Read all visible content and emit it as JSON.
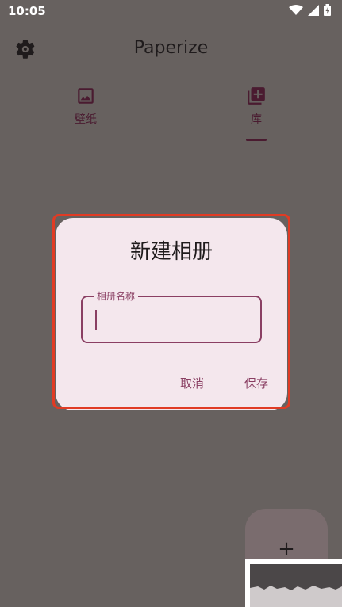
{
  "status_bar": {
    "time": "10:05",
    "icons": [
      "wifi-icon",
      "signal-icon",
      "battery-icon"
    ]
  },
  "app_bar": {
    "title": "Paperize",
    "settings_icon": "gear-icon"
  },
  "tabs": [
    {
      "label": "壁纸",
      "icon": "image-icon",
      "selected": false
    },
    {
      "label": "库",
      "icon": "library-add-icon",
      "selected": true
    }
  ],
  "dialog": {
    "title": "新建相册",
    "field": {
      "label": "相册名称",
      "value": ""
    },
    "cancel_label": "取消",
    "save_label": "保存"
  },
  "fab": {
    "symbol": "+"
  },
  "colors": {
    "scrim": "#67615f",
    "dialog_bg": "#f4e7ed",
    "accent": "#8a3f63",
    "highlight": "#e03b24"
  }
}
